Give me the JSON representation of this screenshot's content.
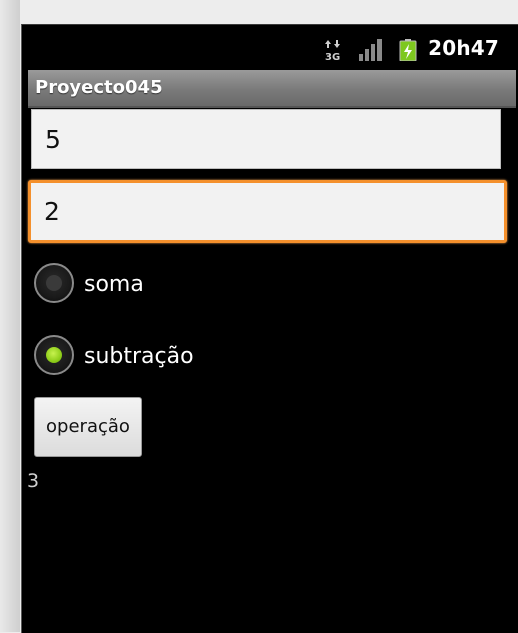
{
  "statusbar": {
    "time": "20h47",
    "network_icon": "3g-data-icon",
    "signal_icon": "signal-strength-icon",
    "battery_icon": "battery-charging-icon"
  },
  "app": {
    "title": "Proyecto045"
  },
  "inputs": {
    "first_value": "5",
    "second_value": "2"
  },
  "options": {
    "soma_label": "soma",
    "subtracao_label": "subtração",
    "selected": "subtração"
  },
  "action": {
    "button_label": "operação"
  },
  "output": {
    "result": "3"
  },
  "colors": {
    "focus_border": "#f4902c",
    "radio_checked": "#8fce1a",
    "titlebar": "#7a7a7a"
  }
}
